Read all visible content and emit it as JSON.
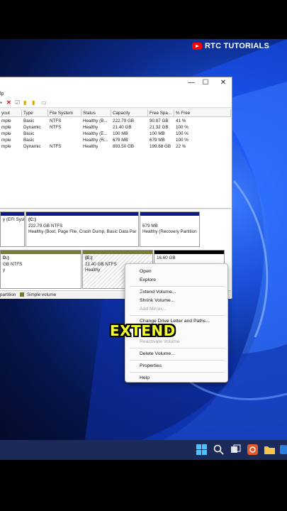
{
  "brand": {
    "name": "RTC TUTORIALS",
    "icon": "youtube-icon"
  },
  "window": {
    "controls": [
      "—",
      "☐",
      "✕"
    ],
    "menu_fragment": "lp",
    "table": {
      "headers": [
        "yout",
        "Type",
        "File System",
        "Status",
        "Capacity",
        "Free Spa...",
        "% Free"
      ],
      "rows": [
        [
          "mple",
          "Basic",
          "NTFS",
          "Healthy (B...",
          "222.79 GB",
          "90.87 GB",
          "41 %"
        ],
        [
          "mple",
          "Dynamic",
          "NTFS",
          "Healthy",
          "21.40 GB",
          "21.32 GB",
          "100 %"
        ],
        [
          "mple",
          "Basic",
          "",
          "Healthy (E...",
          "100 MB",
          "100 MB",
          "100 %"
        ],
        [
          "mple",
          "Basic",
          "",
          "Healthy (R...",
          "679 MB",
          "679 MB",
          "100 %"
        ],
        [
          "mple",
          "Dynamic",
          "NTFS",
          "Healthy",
          "893.50 GB",
          "199.68 GB",
          "22 %"
        ]
      ]
    },
    "disk0": {
      "p1": {
        "line1": "",
        "line2": "y (EFI Syste"
      },
      "p2": {
        "line1": "(C:)",
        "line2": "222.79 GB NTFS",
        "line3": "Healthy (Boot, Page File, Crash Dump, Basic Data Par"
      },
      "p3": {
        "line1": "679 MB",
        "line2": "Healthy (Recovery Partition"
      }
    },
    "disk1": {
      "p1": {
        "line1": "D:)",
        "line2": "GB NTFS",
        "line3": "y"
      },
      "p2": {
        "line1": "(E:)",
        "line2": "21.40 GB NTFS",
        "line3": "Healthy"
      },
      "p3": {
        "line1": "16.60 GB"
      }
    },
    "legend": {
      "partition": "partition",
      "simple": "Simple volume"
    }
  },
  "context_menu": {
    "open": "Open",
    "explore": "Explore",
    "extend": "Extend Volume...",
    "shrink": "Shrink Volume...",
    "add_mirror": "Add Mirror...",
    "change_letter": "Change Drive Letter and Paths...",
    "reactivate": "Reactivate Volume",
    "delete": "Delete Volume...",
    "properties": "Properties",
    "help": "Help"
  },
  "caption": {
    "text": "EXTEND"
  },
  "colors": {
    "accent": "#f3ff2a",
    "disk_bar_blue": "#0a1a8a",
    "dynamic_bar": "#7a7a2a",
    "unalloc_bar": "#000000"
  },
  "taskbar": {
    "icons": [
      "windows-start-icon",
      "search-icon",
      "task-view-icon",
      "app-icon",
      "file-explorer-icon",
      "app-icon-2"
    ]
  }
}
